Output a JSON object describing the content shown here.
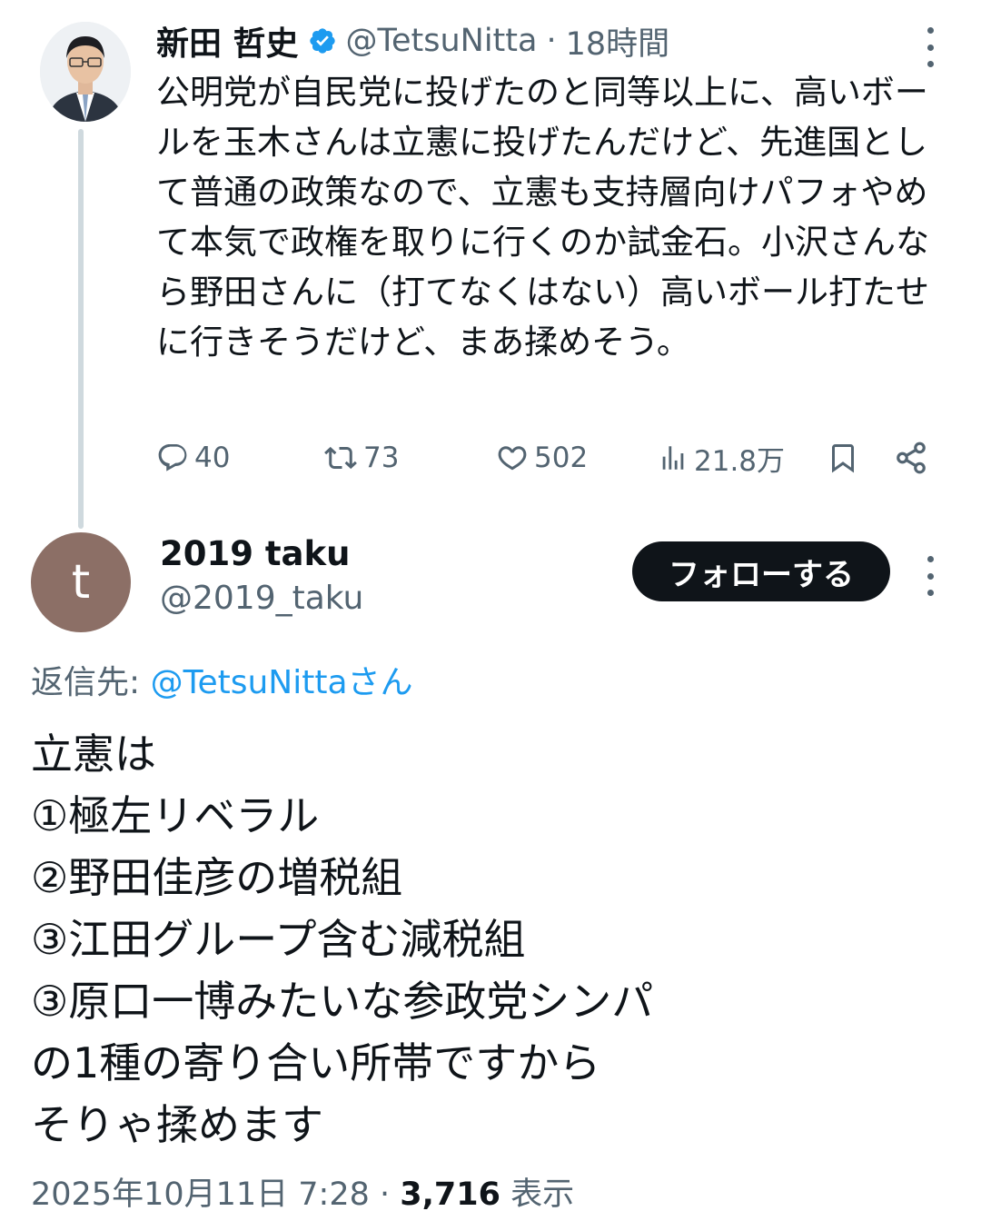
{
  "parent_tweet": {
    "author_name": "新田 哲史",
    "handle": "@TetsuNitta",
    "separator": "·",
    "time": "18時間",
    "text": "公明党が自民党に投げたのと同等以上に、高いボールを玉木さんは立憲に投げたんだけど、先進国として普通の政策なので、立憲も支持層向けパフォやめて本気で政権を取りに行くのか試金石。小沢さんなら野田さんに（打てなくはない）高いボール打たせに行きそうだけど、まあ揉めそう。",
    "replies": "40",
    "retweets": "73",
    "likes": "502",
    "views": "21.8万",
    "verified_color": "#1d9bf0"
  },
  "reply_tweet": {
    "avatar_letter": "t",
    "avatar_color": "#8c6f66",
    "author_name": "2019 taku",
    "handle": "@2019_taku",
    "follow_label": "フォローする",
    "replying_prefix": "返信先: ",
    "replying_mention": "@TetsuNittaさん",
    "lines": [
      "立憲は",
      "①極左リベラル",
      "②野田佳彦の増税組",
      "③江田グループ含む減税組",
      "③原口一博みたいな参政党シンパ",
      "の1種の寄り合い所帯ですから",
      "そりゃ揉めます"
    ],
    "timestamp": "2025年10月11日 7:28",
    "separator": " · ",
    "views_count": "3,716",
    "views_label": " 表示"
  },
  "colors": {
    "text": "#0f1419",
    "secondary": "#536471",
    "link": "#1d9bf0",
    "thread_line": "#cfd9de",
    "button_bg": "#0f1419"
  }
}
